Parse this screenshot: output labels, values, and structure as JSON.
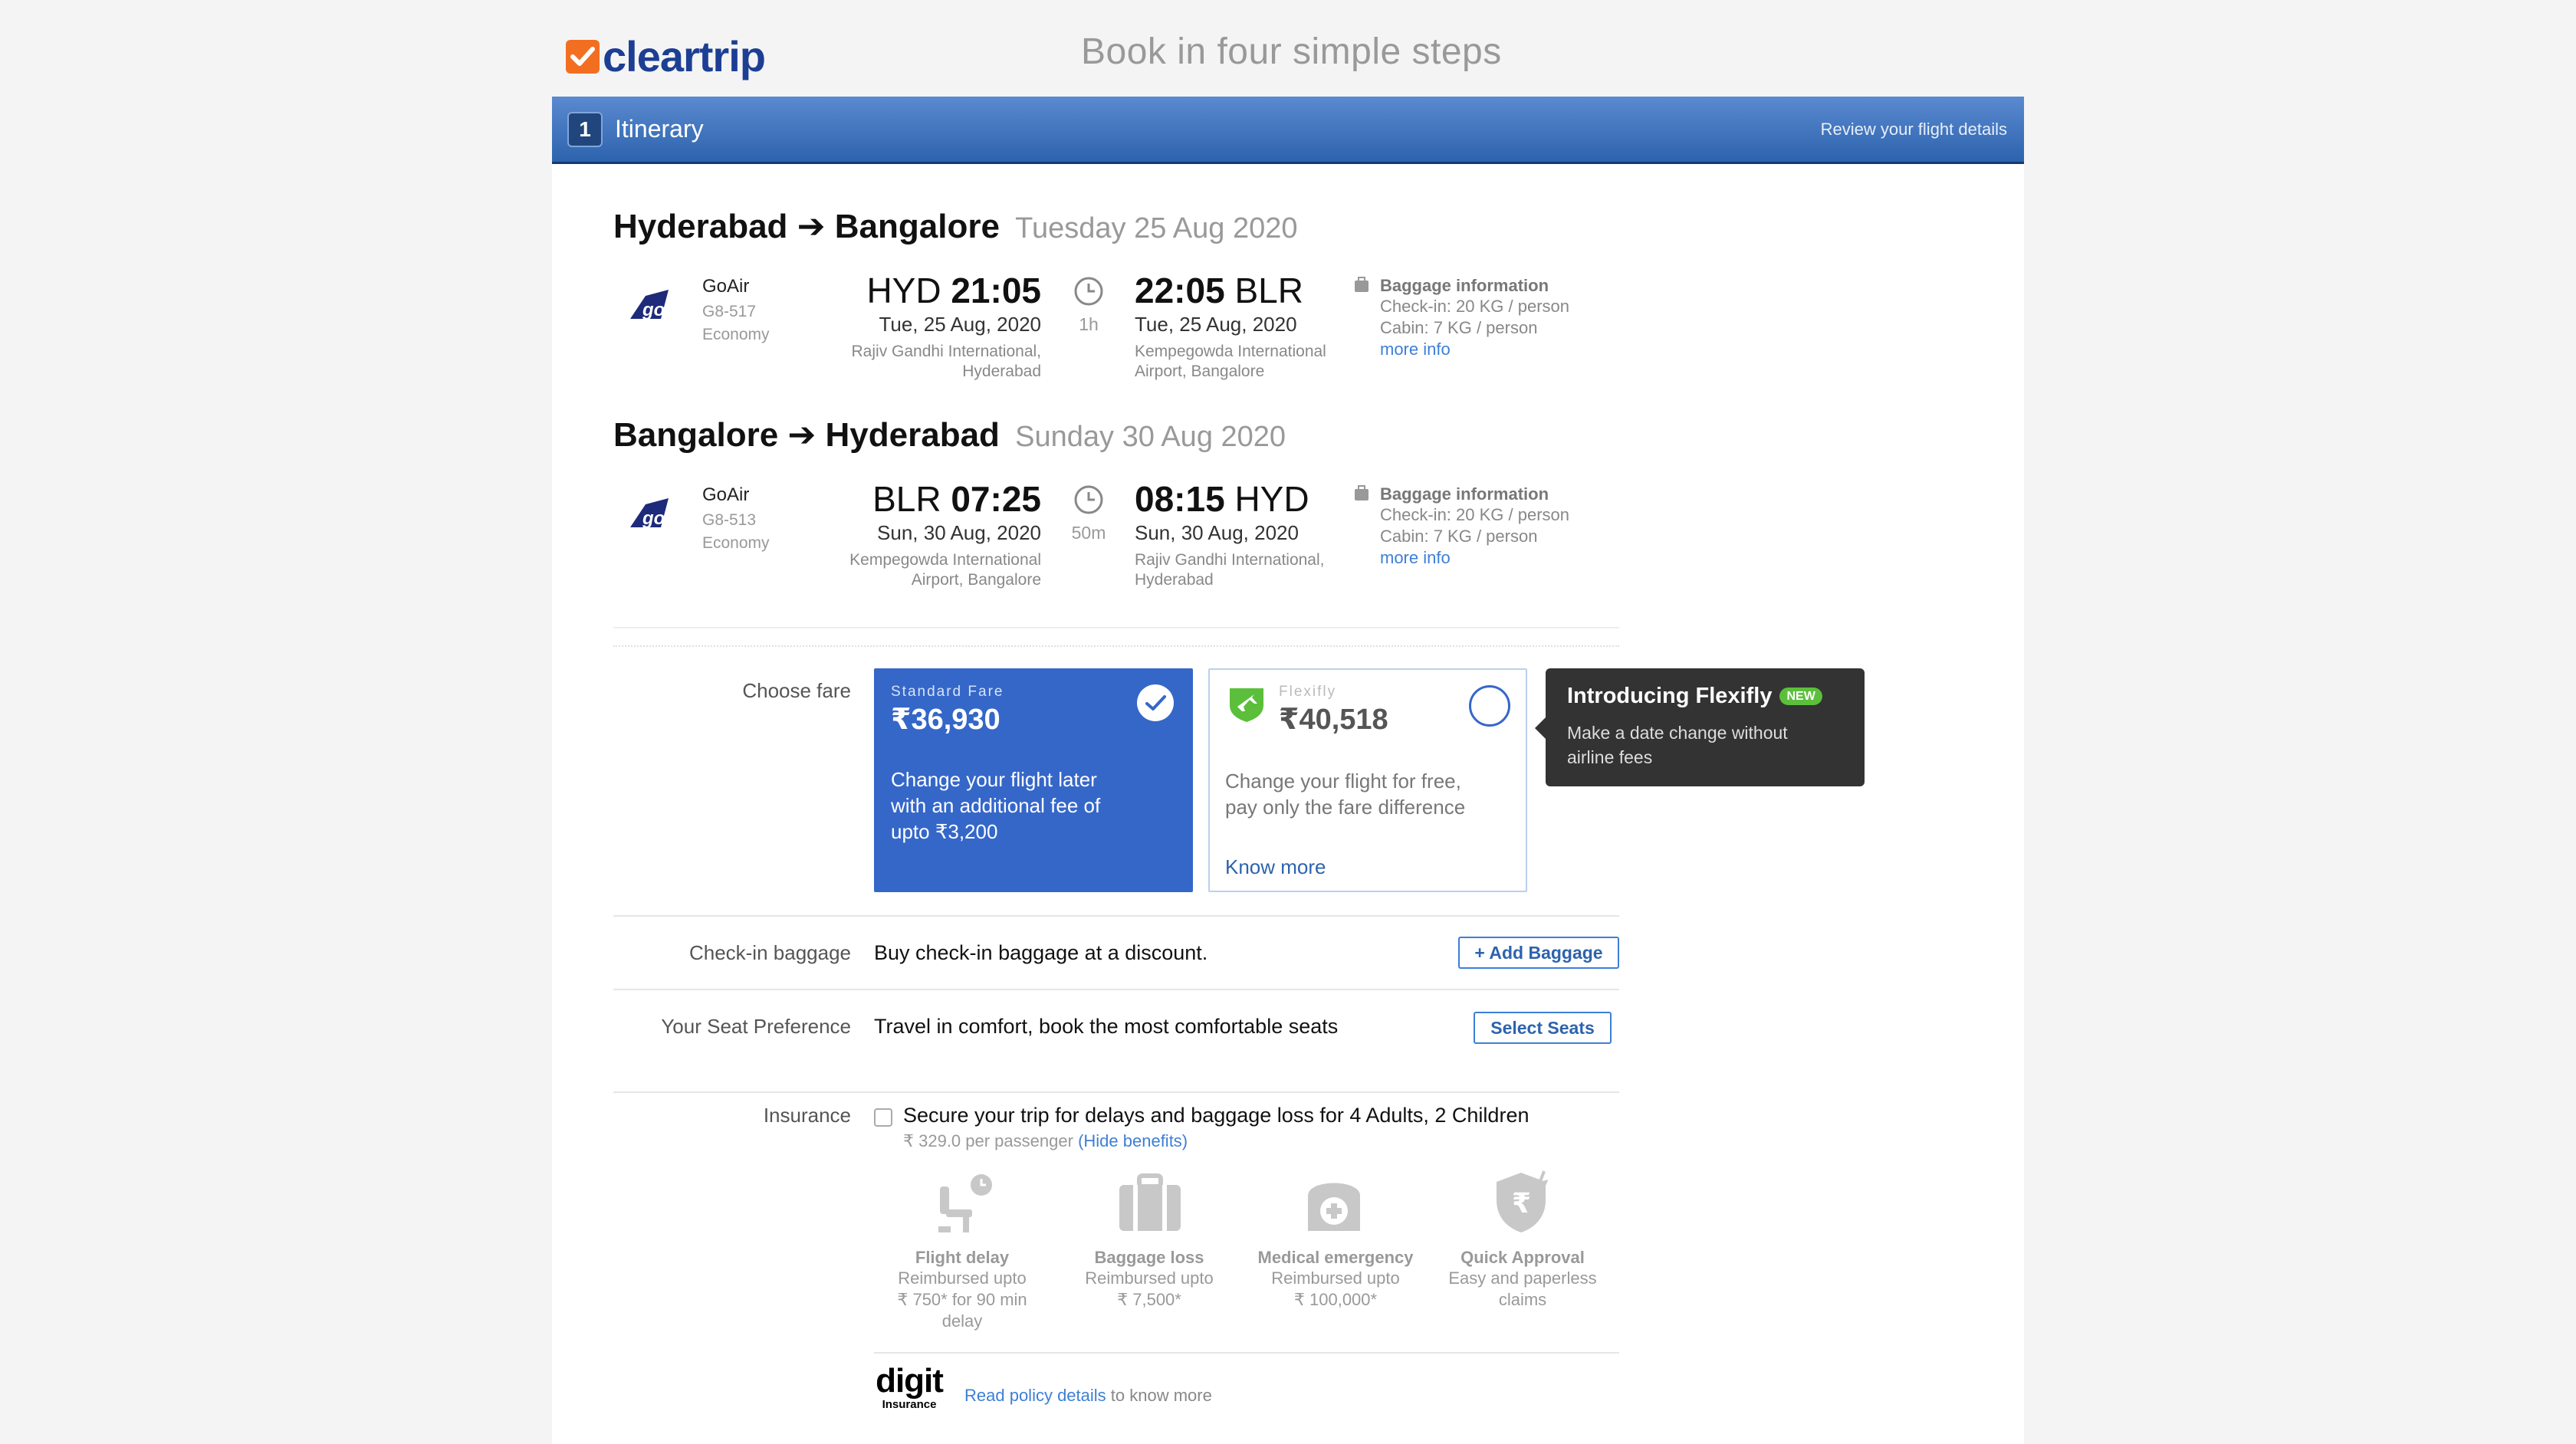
{
  "brand": {
    "name": "cleartrip",
    "tagline": "Book in four simple steps"
  },
  "step": {
    "number": "1",
    "title": "Itinerary",
    "hint": "Review your flight details"
  },
  "flights": [
    {
      "route_from": "Hyderabad",
      "route_to": "Bangalore",
      "route_date": "Tuesday 25 Aug 2020",
      "airline": "GoAir",
      "flight_no": "G8-517",
      "cabin": "Economy",
      "dep_code": "HYD",
      "dep_time": "21:05",
      "dep_date": "Tue, 25 Aug, 2020",
      "dep_airport_1": "Rajiv Gandhi International,",
      "dep_airport_2": "Hyderabad",
      "duration": "1h",
      "arr_code": "BLR",
      "arr_time": "22:05",
      "arr_date": "Tue, 25 Aug, 2020",
      "arr_airport_1": "Kempegowda International",
      "arr_airport_2": "Airport, Bangalore",
      "baggage_title": "Baggage information",
      "checkin": "Check-in: 20 KG / person",
      "cabin_bag": "Cabin: 7 KG / person",
      "more_info": "more info"
    },
    {
      "route_from": "Bangalore",
      "route_to": "Hyderabad",
      "route_date": "Sunday 30 Aug 2020",
      "airline": "GoAir",
      "flight_no": "G8-513",
      "cabin": "Economy",
      "dep_code": "BLR",
      "dep_time": "07:25",
      "dep_date": "Sun, 30 Aug, 2020",
      "dep_airport_1": "Kempegowda International",
      "dep_airport_2": "Airport, Bangalore",
      "duration": "50m",
      "arr_code": "HYD",
      "arr_time": "08:15",
      "arr_date": "Sun, 30 Aug, 2020",
      "arr_airport_1": "Rajiv Gandhi International,",
      "arr_airport_2": "Hyderabad",
      "baggage_title": "Baggage information",
      "checkin": "Check-in: 20 KG / person",
      "cabin_bag": "Cabin: 7 KG / person",
      "more_info": "more info"
    }
  ],
  "fare": {
    "label": "Choose fare",
    "standard": {
      "kicker": "Standard Fare",
      "currency": "₹",
      "price": "36,930",
      "desc_1": "Change your flight later",
      "desc_2": "with an additional fee of",
      "desc_3": "upto ₹3,200",
      "selected": true
    },
    "flexifly": {
      "kicker": "Flexifly",
      "currency": "₹",
      "price": "40,518",
      "desc_1": "Change your flight for free,",
      "desc_2": "pay only the fare difference",
      "link": "Know more",
      "selected": false
    },
    "tooltip": {
      "title": "Introducing Flexifly",
      "badge": "NEW",
      "body_1": "Make a date change without",
      "body_2": "airline fees"
    }
  },
  "baggage": {
    "label": "Check-in baggage",
    "text": "Buy check-in baggage at a discount.",
    "button": "+ Add Baggage"
  },
  "seats": {
    "label": "Your Seat Preference",
    "text": "Travel in comfort, book the most comfortable seats",
    "button": "Select Seats"
  },
  "insurance": {
    "label": "Insurance",
    "text": "Secure your trip for delays and baggage loss for 4 Adults, 2 Children",
    "price": "₹ 329.0 per passenger",
    "hide": "(Hide benefits)",
    "checked": false,
    "benefits": [
      {
        "title": "Flight delay",
        "l1": "Reimbursed upto",
        "l2": "₹ 750* for 90 min",
        "l3": "delay",
        "icon": "seat-clock-icon"
      },
      {
        "title": "Baggage loss",
        "l1": "Reimbursed upto",
        "l2": "₹ 7,500*",
        "l3": "",
        "icon": "suitcase-icon"
      },
      {
        "title": "Medical emergency",
        "l1": "Reimbursed upto",
        "l2": "₹ 100,000*",
        "l3": "",
        "icon": "medical-bag-icon"
      },
      {
        "title": "Quick Approval",
        "l1": "Easy and paperless",
        "l2": "claims",
        "l3": "",
        "icon": "shield-rupee-icon"
      }
    ],
    "provider_logo": "digit",
    "provider_logo_sub": "Insurance",
    "policy_link": "Read policy details",
    "policy_text": "to know more"
  }
}
